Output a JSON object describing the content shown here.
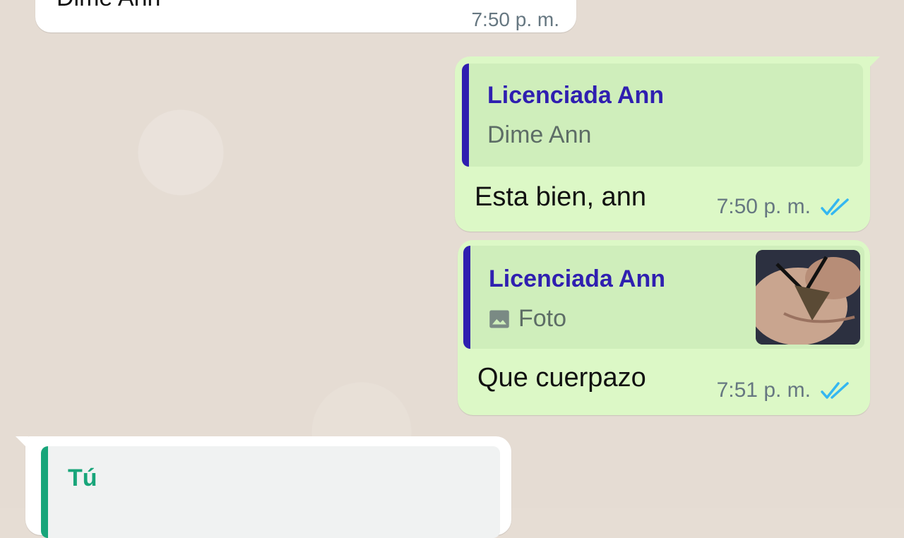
{
  "chat": {
    "messages": [
      {
        "direction": "incoming",
        "text": "Dime Ann",
        "time": "7:50 p. m."
      },
      {
        "direction": "outgoing",
        "quote": {
          "author": "Licenciada Ann",
          "snippet": "Dime Ann"
        },
        "text": "Esta bien, ann",
        "time": "7:50 p. m.",
        "status_icon": "double-check-read-icon"
      },
      {
        "direction": "outgoing",
        "quote": {
          "author": "Licenciada Ann",
          "snippet": "Foto",
          "snippet_icon": "image-icon",
          "has_thumbnail": true
        },
        "text": "Que cuerpazo",
        "time": "7:51 p. m.",
        "status_icon": "double-check-read-icon"
      },
      {
        "direction": "incoming",
        "quote": {
          "author": "Tú",
          "snippet": ""
        },
        "text": ""
      }
    ]
  },
  "colors": {
    "outgoing_bubble": "#dcf8c6",
    "incoming_bubble": "#ffffff",
    "quote_author_other": "#2f1fb0",
    "quote_author_self": "#18a57a",
    "read_ticks": "#34b7f1",
    "timestamp": "#667781"
  }
}
